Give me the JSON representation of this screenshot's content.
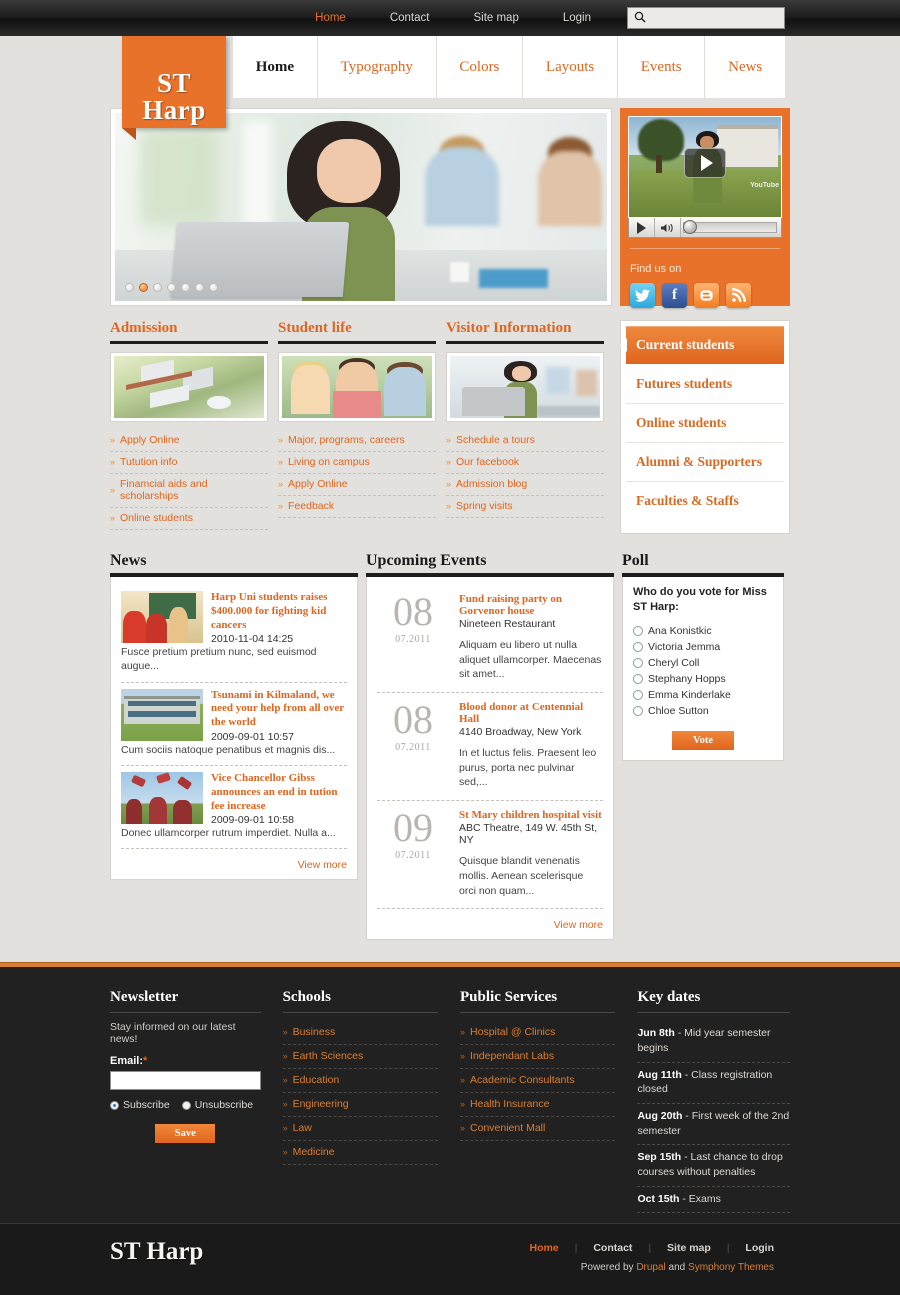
{
  "site": {
    "name": "ST Harp"
  },
  "topbar": {
    "links": [
      {
        "label": "Home",
        "active": true
      },
      {
        "label": "Contact",
        "active": false
      },
      {
        "label": "Site map",
        "active": false
      },
      {
        "label": "Login",
        "active": false
      }
    ],
    "search": {
      "value": "",
      "placeholder": "",
      "icon": "search-icon"
    }
  },
  "mainnav": {
    "items": [
      {
        "label": "Home",
        "active": true
      },
      {
        "label": "Typography",
        "active": false
      },
      {
        "label": "Colors",
        "active": false
      },
      {
        "label": "Layouts",
        "active": false
      },
      {
        "label": "Events",
        "active": false
      },
      {
        "label": "News",
        "active": false
      }
    ]
  },
  "slider": {
    "total_dots": 7,
    "active_dot": 2
  },
  "video": {
    "play_icon": "play-icon",
    "controls": {
      "play_icon": "play-icon",
      "volume_icon": "volume-icon"
    },
    "watermark": "YouTube"
  },
  "social": {
    "heading": "Find us on",
    "items": [
      {
        "name": "twitter-icon",
        "glyph": "t"
      },
      {
        "name": "facebook-icon",
        "glyph": "f"
      },
      {
        "name": "blogger-icon",
        "glyph": "B"
      },
      {
        "name": "rss-icon",
        "glyph": "◔"
      }
    ]
  },
  "promos": [
    {
      "title": "Admission",
      "links": [
        "Apply Online",
        "Tutution info",
        "Finamcial aids and scholarships",
        "Online students"
      ]
    },
    {
      "title": "Student life",
      "links": [
        "Major, programs, careers",
        "Living on campus",
        "Apply Online",
        "Feedback"
      ]
    },
    {
      "title": "Visitor Information",
      "links": [
        "Schedule a tours",
        "Our facebook",
        "Admission blog",
        "Spring visits"
      ]
    }
  ],
  "sidemenu": {
    "items": [
      {
        "label": "Current students",
        "active": true
      },
      {
        "label": "Futures students",
        "active": false
      },
      {
        "label": "Online students",
        "active": false
      },
      {
        "label": "Alumni & Supporters",
        "active": false
      },
      {
        "label": "Faculties & Staffs",
        "active": false
      }
    ]
  },
  "news": {
    "title": "News",
    "items": [
      {
        "title": "Harp Uni students raises $400.000 for fighting kid cancers",
        "date": "2010-11-04 14:25",
        "text": "Fusce pretium pretium nunc, sed euismod augue..."
      },
      {
        "title": "Tsunami in Kilmaland, we need your help from all over the world",
        "date": "2009-09-01 10:57",
        "text": "Cum sociis natoque penatibus et magnis dis..."
      },
      {
        "title": "Vice Chancellor Gibss announces an end in tution fee increase",
        "date": "2009-09-01 10:58",
        "text": "Donec ullamcorper rutrum imperdiet. Nulla a..."
      }
    ],
    "view_more": "View more"
  },
  "events": {
    "title": "Upcoming Events",
    "items": [
      {
        "day": "08",
        "month": "07.2011",
        "title": "Fund raising party on Gorvenor house",
        "place": "Nineteen Restaurant",
        "desc": "Aliquam eu libero ut nulla aliquet ullamcorper. Maecenas sit amet..."
      },
      {
        "day": "08",
        "month": "07.2011",
        "title": "Blood donor at Centennial Hall",
        "place": "4140 Broadway, New York",
        "desc": "In et luctus felis. Praesent leo purus, porta nec pulvinar sed,..."
      },
      {
        "day": "09",
        "month": "07.2011",
        "title": "St Mary children hospital visit",
        "place": "ABC Theatre, 149 W. 45th St, NY",
        "desc": "Quisque blandit venenatis mollis. Aenean scelerisque orci non quam..."
      }
    ],
    "view_more": "View more"
  },
  "poll": {
    "title": "Poll",
    "question": "Who do you vote for Miss ST Harp:",
    "options": [
      "Ana Konistkic",
      "Victoria Jemma",
      "Cheryl Coll",
      "Stephany Hopps",
      "Emma Kinderlake",
      "Chloe Sutton"
    ],
    "selected": null,
    "button": "Vote"
  },
  "footer": {
    "newsletter": {
      "title": "Newsletter",
      "text": "Stay informed on our latest news!",
      "email_label": "Email:",
      "email_required": "*",
      "email_value": "",
      "email_placeholder": "",
      "options": [
        {
          "label": "Subscribe",
          "selected": true
        },
        {
          "label": "Unsubscribe",
          "selected": false
        }
      ],
      "button": "Save"
    },
    "schools": {
      "title": "Schools",
      "links": [
        "Business",
        "Earth Sciences",
        "Education",
        "Engineering",
        "Law",
        "Medicine"
      ]
    },
    "services": {
      "title": "Public Services",
      "links": [
        "Hospital @ Clinics",
        "Independant Labs",
        "Academic Consultants",
        "Health Insurance",
        "Convenient Mall"
      ]
    },
    "keydates": {
      "title": "Key dates",
      "items": [
        {
          "date": "Jun 8th",
          "text": "- Mid year semester begins"
        },
        {
          "date": "Aug 11th",
          "text": "- Class registration closed"
        },
        {
          "date": "Aug 20th",
          "text": "- First week of the 2nd semester"
        },
        {
          "date": "Sep 15th",
          "text": "- Last chance to drop courses without penalties"
        },
        {
          "date": "Oct 15th",
          "text": "- Exams"
        }
      ]
    },
    "bottom": {
      "logo": "ST Harp",
      "links": [
        {
          "label": "Home",
          "active": true
        },
        {
          "label": "Contact",
          "active": false
        },
        {
          "label": "Site map",
          "active": false
        },
        {
          "label": "Login",
          "active": false
        }
      ],
      "powered_prefix": "Powered by ",
      "powered_link1": "Drupal",
      "powered_mid": " and ",
      "powered_link2": "Symphony Themes"
    }
  },
  "colors": {
    "accent": "#e8722a",
    "accent_dark": "#e0651f",
    "dark": "#222121",
    "bg": "#e3e1dd"
  }
}
